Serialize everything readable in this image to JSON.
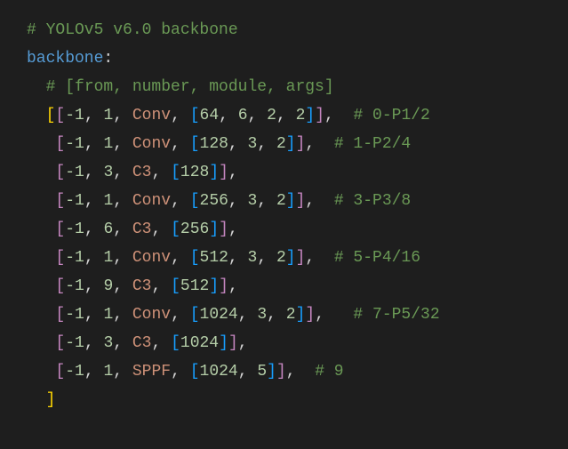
{
  "comment_top": "# YOLOv5 v6.0 backbone",
  "key": "backbone",
  "colon": ":",
  "comment_cols": "# [from, number, module, args]",
  "rows": [
    {
      "from": "-1",
      "n": "1",
      "module": "Conv",
      "args": [
        "64",
        "6",
        "2",
        "2"
      ],
      "trail_comma": true,
      "lead": "[",
      "comment": "# 0-P1/2",
      "sp": "  "
    },
    {
      "from": "-1",
      "n": "1",
      "module": "Conv",
      "args": [
        "128",
        "3",
        "2"
      ],
      "trail_comma": true,
      "lead": " ",
      "comment": "# 1-P2/4",
      "sp": "  "
    },
    {
      "from": "-1",
      "n": "3",
      "module": "C3",
      "args": [
        "128"
      ],
      "trail_comma": true,
      "lead": " ",
      "comment": "",
      "sp": ""
    },
    {
      "from": "-1",
      "n": "1",
      "module": "Conv",
      "args": [
        "256",
        "3",
        "2"
      ],
      "trail_comma": true,
      "lead": " ",
      "comment": "# 3-P3/8",
      "sp": "  "
    },
    {
      "from": "-1",
      "n": "6",
      "module": "C3",
      "args": [
        "256"
      ],
      "trail_comma": true,
      "lead": " ",
      "comment": "",
      "sp": ""
    },
    {
      "from": "-1",
      "n": "1",
      "module": "Conv",
      "args": [
        "512",
        "3",
        "2"
      ],
      "trail_comma": true,
      "lead": " ",
      "comment": "# 5-P4/16",
      "sp": "  "
    },
    {
      "from": "-1",
      "n": "9",
      "module": "C3",
      "args": [
        "512"
      ],
      "trail_comma": true,
      "lead": " ",
      "comment": "",
      "sp": ""
    },
    {
      "from": "-1",
      "n": "1",
      "module": "Conv",
      "args": [
        "1024",
        "3",
        "2"
      ],
      "trail_comma": true,
      "lead": " ",
      "comment": "# 7-P5/32",
      "sp": "   "
    },
    {
      "from": "-1",
      "n": "3",
      "module": "C3",
      "args": [
        "1024"
      ],
      "trail_comma": true,
      "lead": " ",
      "comment": "",
      "sp": ""
    },
    {
      "from": "-1",
      "n": "1",
      "module": "SPPF",
      "args": [
        "1024",
        "5"
      ],
      "trail_comma": true,
      "lead": " ",
      "comment": "# 9",
      "sp": "  "
    }
  ],
  "close": "]"
}
